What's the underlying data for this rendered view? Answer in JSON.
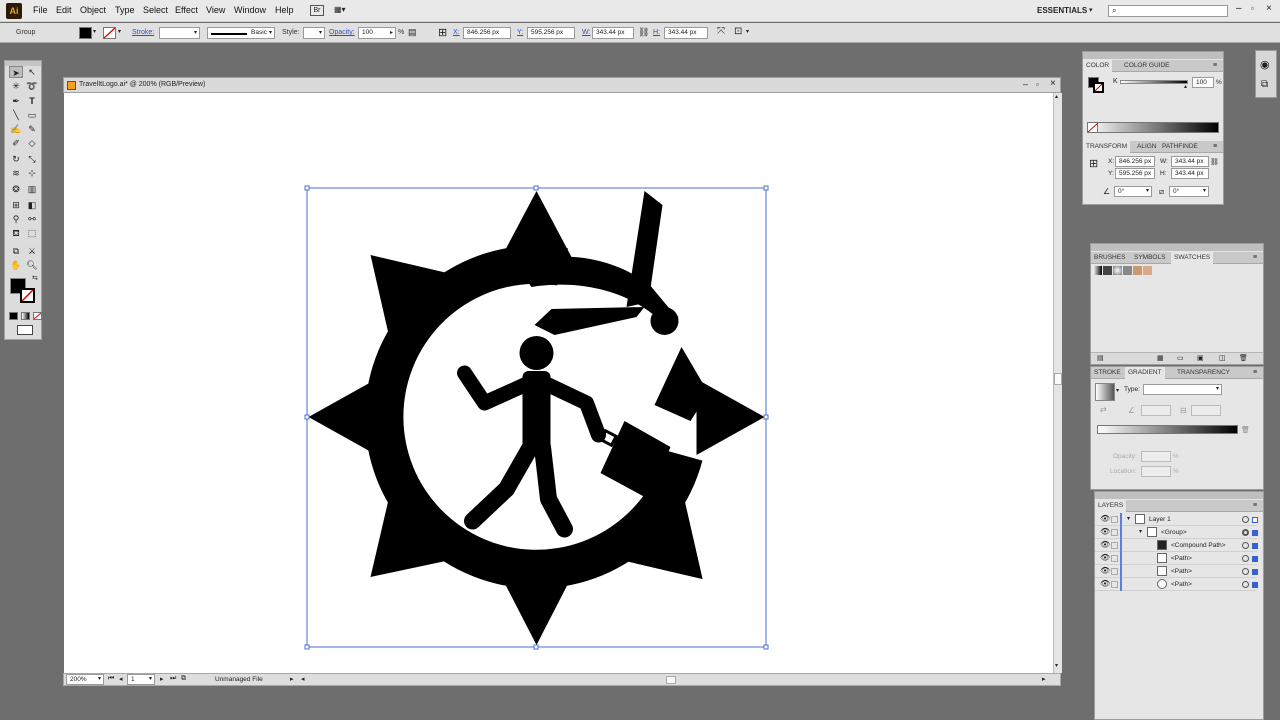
{
  "app": {
    "logo": "Ai",
    "workspace": "ESSENTIALS",
    "search_placeholder": ""
  },
  "menu": [
    "File",
    "Edit",
    "Object",
    "Type",
    "Select",
    "Effect",
    "View",
    "Window",
    "Help"
  ],
  "control_bar": {
    "selection": "Group",
    "stroke_label": "Stroke:",
    "brush": "Basic",
    "style_label": "Style:",
    "opacity_label": "Opacity:",
    "opacity": "100",
    "opacity_unit": "%",
    "x_label": "X:",
    "x": "846.256 px",
    "y_label": "Y:",
    "y": "595.256 px",
    "w_label": "W:",
    "w": "343.44 px",
    "h_label": "H:",
    "h": "343.44 px"
  },
  "document": {
    "title": "TravelItLogo.ai* @ 200% (RGB/Preview)",
    "zoom": "200%",
    "page": "1",
    "status": "Unmanaged File"
  },
  "color_panel": {
    "tabs": [
      "COLOR",
      "COLOR GUIDE"
    ],
    "channel_label": "K",
    "value": "100",
    "unit": "%"
  },
  "transform_panel": {
    "tabs": [
      "TRANSFORM",
      "ALIGN",
      "PATHFINDE"
    ],
    "x_label": "X:",
    "x": "846.256 px",
    "y_label": "Y:",
    "y": "595.256 px",
    "w_label": "W:",
    "w": "343.44 px",
    "h_label": "H:",
    "h": "343.44 px",
    "angle": "0°",
    "shear": "0°"
  },
  "swatches_panel": {
    "tabs": [
      "BRUSHES",
      "SYMBOLS",
      "SWATCHES"
    ]
  },
  "gradient_panel": {
    "tabs": [
      "STROKE",
      "GRADIENT",
      "TRANSPARENCY"
    ],
    "type_label": "Type:",
    "opacity_label": "Opacity:",
    "location_label": "Location:",
    "unit": "%"
  },
  "layers_panel": {
    "title": "LAYERS",
    "rows": [
      {
        "label": "Layer 1",
        "indent": 0
      },
      {
        "label": "<Group>",
        "indent": 1
      },
      {
        "label": "<Compound Path>",
        "indent": 2
      },
      {
        "label": "<Path>",
        "indent": 2
      },
      {
        "label": "<Path>",
        "indent": 2
      },
      {
        "label": "<Path>",
        "indent": 2
      }
    ]
  },
  "colors": {
    "accent": "#3a5fd0",
    "fill": "#000000"
  }
}
